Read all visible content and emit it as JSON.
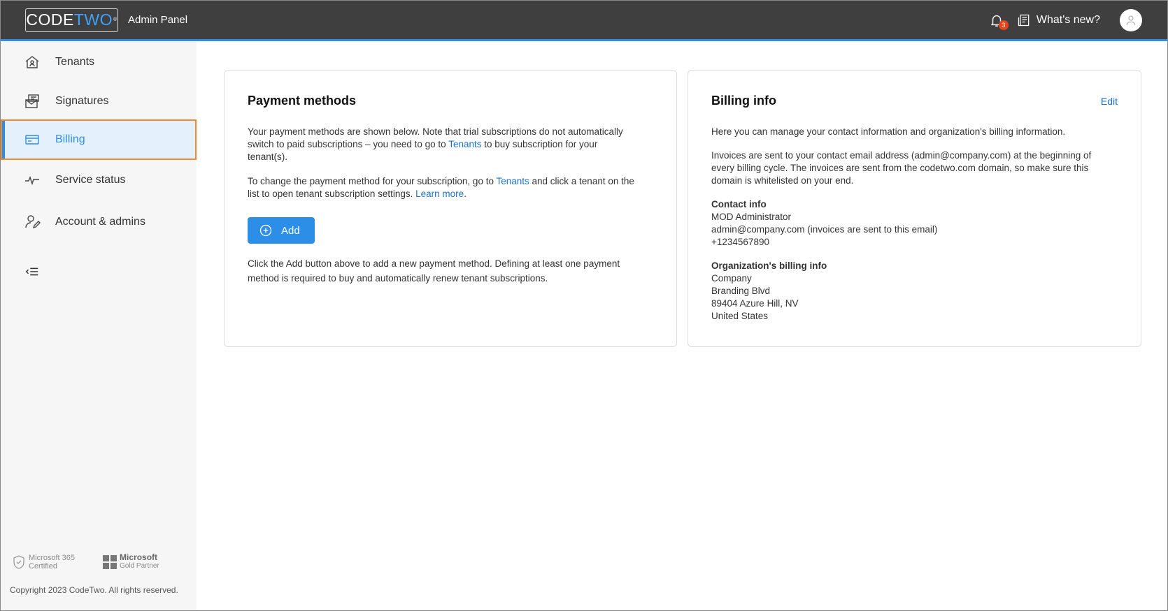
{
  "header": {
    "logo_part1": "CODE",
    "logo_part2": "TWO",
    "logo_mark": "®",
    "app_title": "Admin Panel",
    "notification_count": "3",
    "whats_new_label": "What's new?"
  },
  "sidebar": {
    "items": [
      {
        "label": "Tenants",
        "icon": "home-icon"
      },
      {
        "label": "Signatures",
        "icon": "signature-icon"
      },
      {
        "label": "Billing",
        "icon": "card-icon",
        "active": true
      },
      {
        "label": "Service status",
        "icon": "pulse-icon"
      },
      {
        "label": "Account & admins",
        "icon": "user-edit-icon"
      }
    ],
    "badge1_line1": "Microsoft 365",
    "badge1_line2": "Certified",
    "badge2_line1": "Microsoft",
    "badge2_line2": "Gold Partner",
    "copyright": "Copyright 2023 CodeTwo. All rights reserved."
  },
  "payment": {
    "title": "Payment methods",
    "p1_a": "Your payment methods are shown below. Note that trial subscriptions do not automatically",
    "p1_b_pre": "switch to paid subscriptions – you need to go to ",
    "p1_b_link": "Tenants",
    "p1_b_post": " to buy subscription for your",
    "p1_c": "tenant(s).",
    "p2_a_pre": "To change the payment method for your subscription, go to ",
    "p2_a_link": "Tenants",
    "p2_a_post": " and click a tenant on the",
    "p2_b_pre": "list to open tenant subscription settings. ",
    "p2_b_link": "Learn more",
    "p2_b_post": ".",
    "add_label": "Add",
    "p3_a": "Click the Add button above to add a new payment method. Defining at least one payment",
    "p3_b": "method is required to buy and automatically renew tenant subscriptions."
  },
  "billing": {
    "title": "Billing info",
    "edit_label": "Edit",
    "intro": "Here you can manage your contact information and organization's billing information.",
    "inv_a": "Invoices are sent to your contact email address (admin@company.com) at the beginning of",
    "inv_b": "every billing cycle. The invoices are sent from the codetwo.com domain, so make sure this",
    "inv_c": "domain is whitelisted on your end.",
    "contact_heading": "Contact info",
    "contact_name": "MOD Administrator",
    "contact_email": "admin@company.com (invoices are sent to this email)",
    "contact_phone": "+1234567890",
    "org_heading": "Organization's billing info",
    "org_name": "Company",
    "org_street": "Branding Blvd",
    "org_city": "89404 Azure Hill, NV",
    "org_country": "United States"
  },
  "colors": {
    "accent": "#2d8ee8",
    "topbar": "#3f3f3f",
    "highlight_border": "#f08a36",
    "badge": "#e8431a"
  }
}
